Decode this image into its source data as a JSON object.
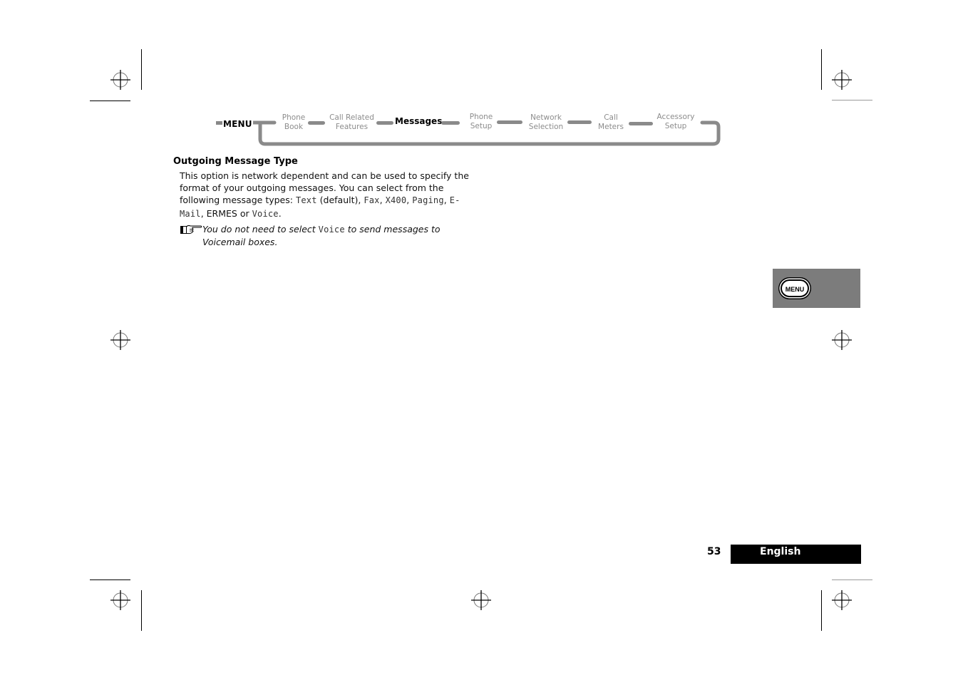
{
  "navigation": {
    "root_label": "MENU",
    "items": [
      {
        "line1": "Phone",
        "line2": "Book",
        "active": false
      },
      {
        "line1": "Call Related",
        "line2": "Features",
        "active": false
      },
      {
        "line1": "Messages",
        "line2": "",
        "active": true
      },
      {
        "line1": "Phone",
        "line2": "Setup",
        "active": false
      },
      {
        "line1": "Network",
        "line2": "Selection",
        "active": false
      },
      {
        "line1": "Call",
        "line2": "Meters",
        "active": false
      },
      {
        "line1": "Accessory",
        "line2": "Setup",
        "active": false
      }
    ]
  },
  "section": {
    "heading": "Outgoing Message Type",
    "paragraph": {
      "intro": "This option is network dependent and can be used to specify the format of your outgoing messages. You can select from the following message types: ",
      "types": [
        "Text",
        "Fax",
        "X400",
        "Paging",
        "E-Mail",
        "ERMES",
        "Voice"
      ],
      "default_suffix": " (default)",
      "sep_comma": ", ",
      "sep_or": " or ",
      "end": "."
    },
    "note": {
      "icon": "pointing-hand-icon",
      "before": "You do not need to select ",
      "code": "Voice",
      "after": " to send messages to Voicemail boxes."
    }
  },
  "side_tab": {
    "key_label": "MENU",
    "background": "#7c7c7c"
  },
  "footer": {
    "page_number": "53",
    "language": "English"
  }
}
